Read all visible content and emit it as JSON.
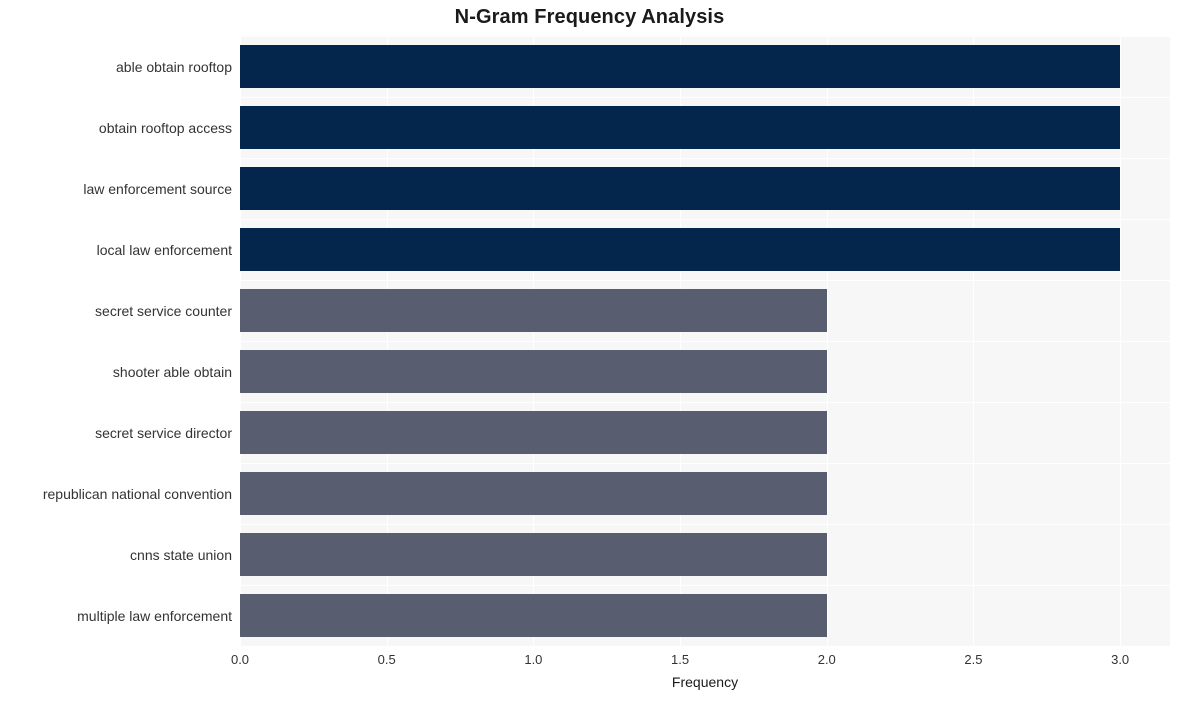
{
  "chart_data": {
    "type": "bar",
    "orientation": "horizontal",
    "title": "N-Gram Frequency Analysis",
    "xlabel": "Frequency",
    "ylabel": "",
    "xlim": [
      0,
      3.17
    ],
    "xticks": [
      0.0,
      0.5,
      1.0,
      1.5,
      2.0,
      2.5,
      3.0
    ],
    "xtick_labels": [
      "0.0",
      "0.5",
      "1.0",
      "1.5",
      "2.0",
      "2.5",
      "3.0"
    ],
    "grid": true,
    "legend": "none",
    "categories": [
      "able obtain rooftop",
      "obtain rooftop access",
      "law enforcement source",
      "local law enforcement",
      "secret service counter",
      "shooter able obtain",
      "secret service director",
      "republican national convention",
      "cnns state union",
      "multiple law enforcement"
    ],
    "values": [
      3,
      3,
      3,
      3,
      2,
      2,
      2,
      2,
      2,
      2
    ],
    "bar_colors": [
      "#04254c",
      "#04254c",
      "#04254c",
      "#04254c",
      "#585e6f",
      "#585e6f",
      "#585e6f",
      "#585e6f",
      "#585e6f",
      "#585e6f"
    ]
  },
  "style": {
    "plot_background": "#f7f7f7",
    "figure_background": "#ffffff",
    "gridline_color": "#ffffff",
    "text_color": "#333333",
    "title_color": "#1a1a1a",
    "color_high": "#04254c",
    "color_low": "#585e6f"
  }
}
